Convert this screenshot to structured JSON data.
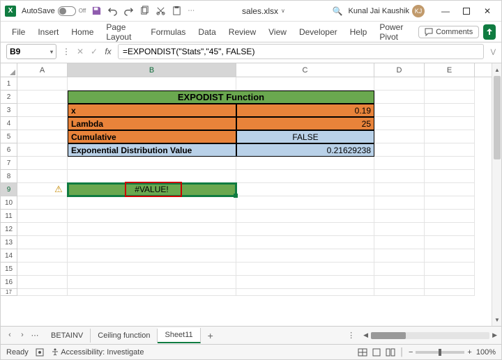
{
  "titlebar": {
    "autosave_label": "AutoSave",
    "autosave_state": "Off",
    "filename": "sales.xlsx",
    "app_letter": "X",
    "search_icon": "🔍",
    "user_name": "Kunal Jai Kaushik",
    "user_initials": "KJ"
  },
  "ribbon": {
    "tabs": [
      "File",
      "Insert",
      "Home",
      "Page Layout",
      "Formulas",
      "Data",
      "Review",
      "View",
      "Developer",
      "Help",
      "Power Pivot"
    ],
    "comments_label": "Comments"
  },
  "formula_bar": {
    "name_box": "B9",
    "formula": "=EXPONDIST(\"Stats\",\"45\", FALSE)"
  },
  "columns": [
    "A",
    "B",
    "C",
    "D",
    "E"
  ],
  "row_numbers": [
    "1",
    "2",
    "3",
    "4",
    "5",
    "6",
    "7",
    "8",
    "9",
    "10",
    "11",
    "12",
    "13",
    "14",
    "15",
    "16",
    "17"
  ],
  "table": {
    "header": "EXPODIST Function",
    "rows": [
      {
        "label": "x",
        "value": "0.19"
      },
      {
        "label": "Lambda",
        "value": "25"
      },
      {
        "label": "Cumulative",
        "value": "FALSE"
      },
      {
        "label": "Exponential Distribution Value",
        "value": "0.21629238"
      }
    ]
  },
  "error_cell": "#VALUE!",
  "sheets": {
    "tabs": [
      "BETAINV",
      "Ceiling function",
      "Sheet11"
    ],
    "active": "Sheet11",
    "ellipsis": "⋯"
  },
  "statusbar": {
    "ready": "Ready",
    "accessibility": "Accessibility: Investigate",
    "zoom": "100%"
  }
}
